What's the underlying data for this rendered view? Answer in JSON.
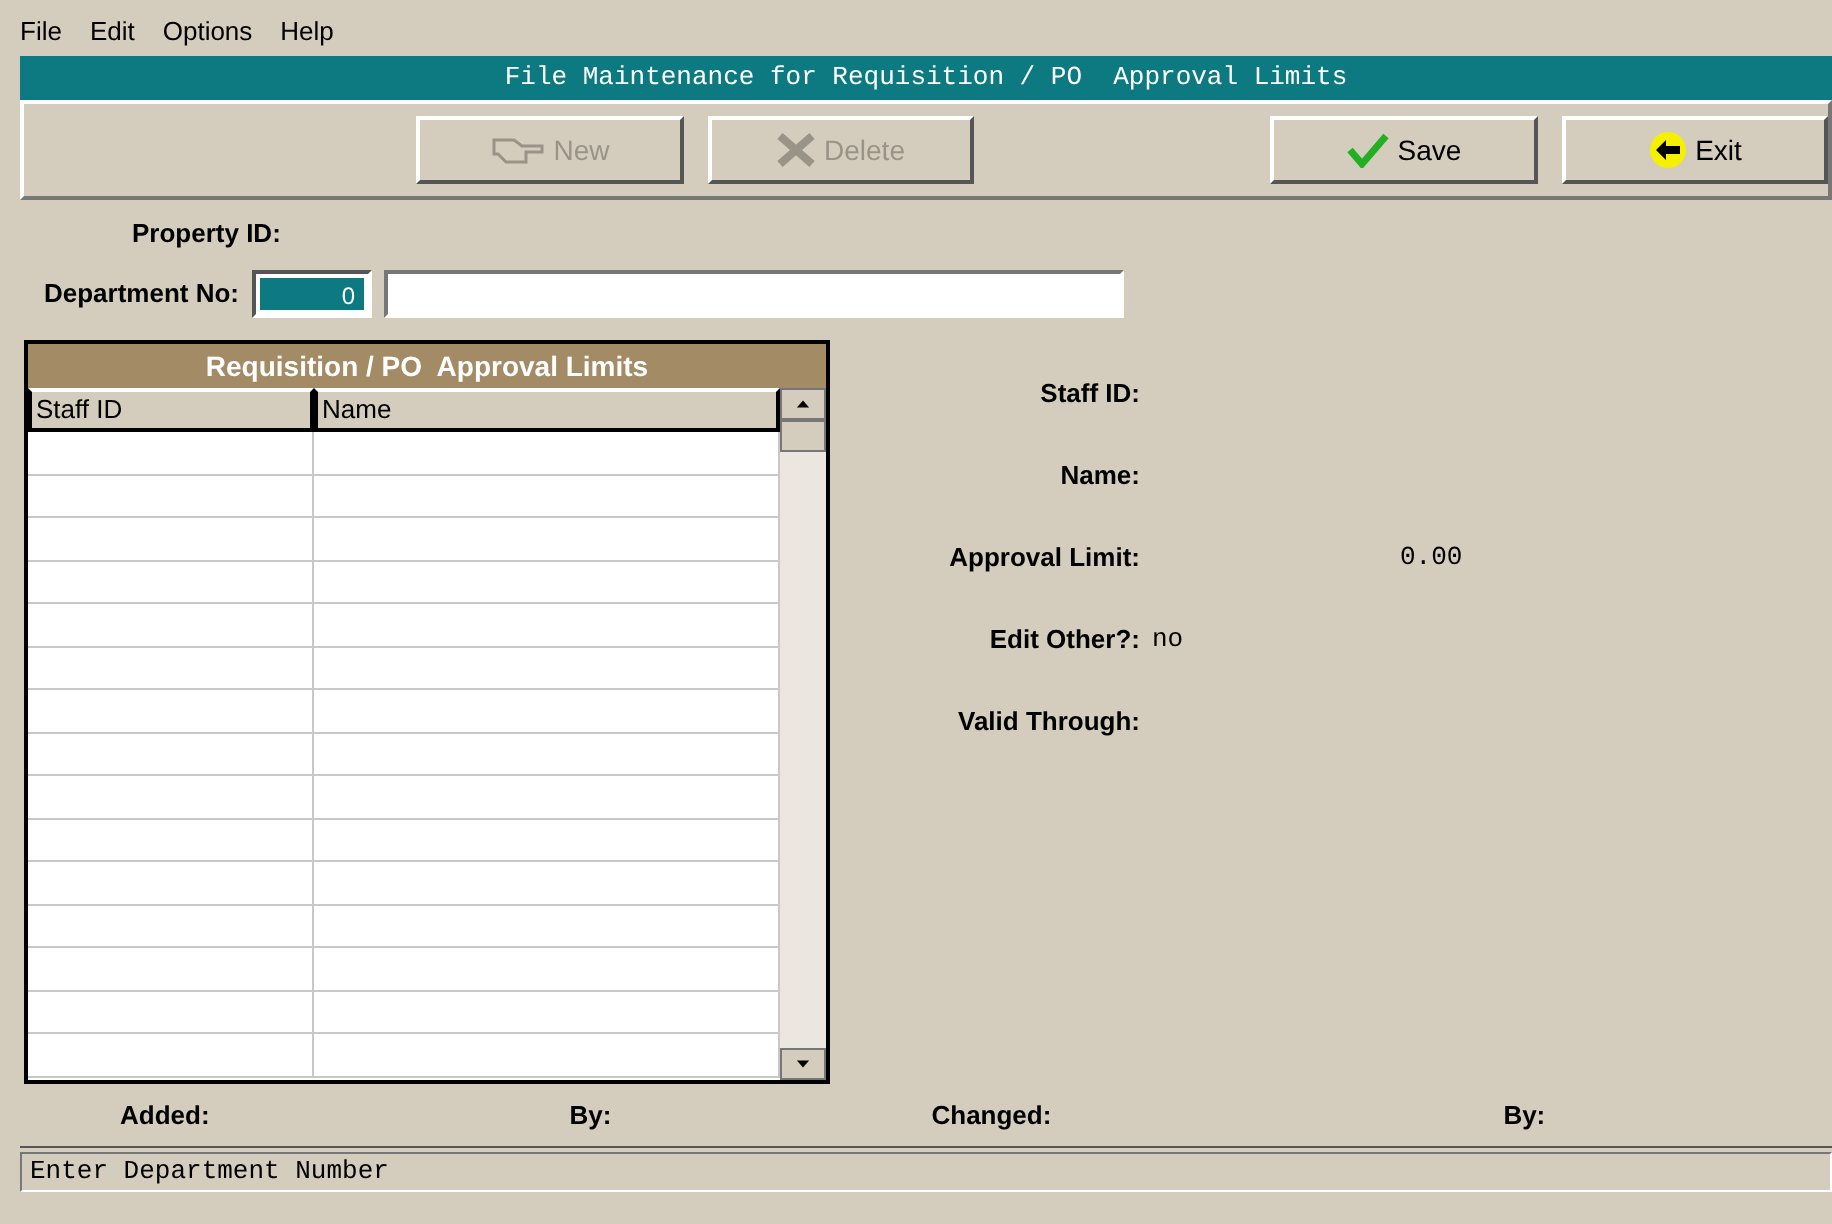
{
  "menu": [
    "File",
    "Edit",
    "Options",
    "Help"
  ],
  "title": "File Maintenance for Requisition / PO  Approval Limits",
  "toolbar": [
    {
      "kind": "new",
      "label": "New",
      "disabled": true
    },
    {
      "kind": "delete",
      "label": "Delete",
      "disabled": true
    },
    {
      "kind": "save",
      "label": "Save",
      "disabled": false
    },
    {
      "kind": "exit",
      "label": "Exit",
      "disabled": false
    }
  ],
  "property_label": "Property ID:",
  "department": {
    "label": "Department No:",
    "value": "0",
    "highlighted": true
  },
  "grid": {
    "title": "Requisition / PO  Approval Limits",
    "columns": [
      "Staff ID",
      "Name"
    ]
  },
  "details": [
    {
      "label": "Staff ID:"
    },
    {
      "label": "Name:"
    },
    {
      "label": "Approval Limit:",
      "value": "0.00"
    },
    {
      "label": "Edit Other?:",
      "value": "no"
    },
    {
      "label": "Valid Through:"
    }
  ],
  "footer": [
    "Added:",
    "By:",
    "Changed:",
    "By:"
  ],
  "status_bar": "Enter Department Number"
}
